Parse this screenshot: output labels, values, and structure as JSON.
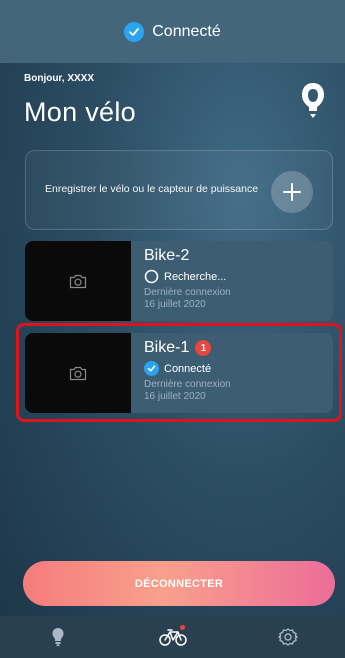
{
  "status_bar": {
    "connection_text": "Connecté"
  },
  "header": {
    "greeting": "Bonjour, XXXX",
    "title": "Mon vélo"
  },
  "register_card": {
    "label": "Enregistrer le vélo ou le capteur de puissance"
  },
  "bikes": [
    {
      "name": "Bike-2",
      "status": "Recherche...",
      "meta_label": "Dernière connexion",
      "meta_date": "16 juillet 2020"
    },
    {
      "name": "Bike-1",
      "badge": "1",
      "status": "Connecté",
      "meta_label": "Dernière connexion",
      "meta_date": "16 juillet 2020"
    }
  ],
  "actions": {
    "disconnect_label": "DÉCONNECTER"
  },
  "bottom_nav": {
    "items": [
      "lightbulb-icon",
      "bike-icon",
      "settings-icon"
    ],
    "active": "bike-icon"
  },
  "colors": {
    "accent": "#2aa4f1",
    "highlight": "#e0131b",
    "badge": "#e8463f"
  }
}
